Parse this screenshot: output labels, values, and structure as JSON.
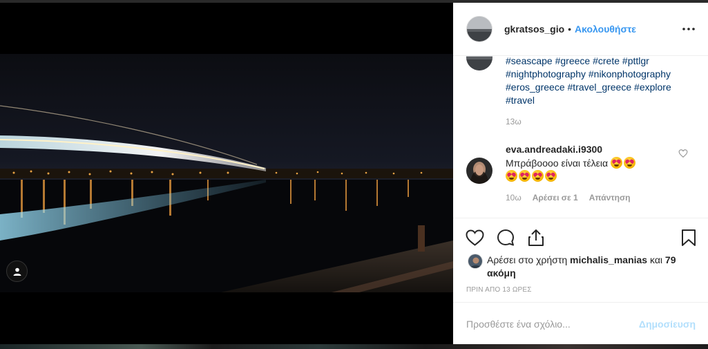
{
  "post": {
    "owner_username": "gkratsos_gio",
    "follow_label": "Ακολουθήστε",
    "separator": "•",
    "caption_hashtags": [
      "#seascape",
      "#greece",
      "#crete",
      "#pttlgr",
      "#nightphotography",
      "#nikonphotography",
      "#eros_greece",
      "#travel_greece",
      "#explore",
      "#travel"
    ],
    "caption_time": "13ω"
  },
  "comment": {
    "username": "eva.andreadaki.i9300",
    "text": "Μπράβοοοο είναι τέλεια",
    "emoji_count_line1": 2,
    "emoji_count_line2": 4,
    "emoji_name": "heart-eyes",
    "time": "10ω",
    "likes_label": "Αρέσει σε 1",
    "reply_label": "Απάντηση"
  },
  "likes": {
    "prefix": "Αρέσει στο χρήστη",
    "liker": "michalis_manias",
    "joiner": "και",
    "others": "79 ακόμη"
  },
  "post_time": "ΠΡΙΝ ΑΠΟ 13 ΩΡΕΣ",
  "add_comment": {
    "placeholder": "Προσθέστε ένα σχόλιο...",
    "post_label": "Δημοσίευση"
  },
  "colors": {
    "link_blue": "#3897f0",
    "hashtag": "#003569",
    "post_disabled": "#b2dffc",
    "muted": "#999999"
  }
}
